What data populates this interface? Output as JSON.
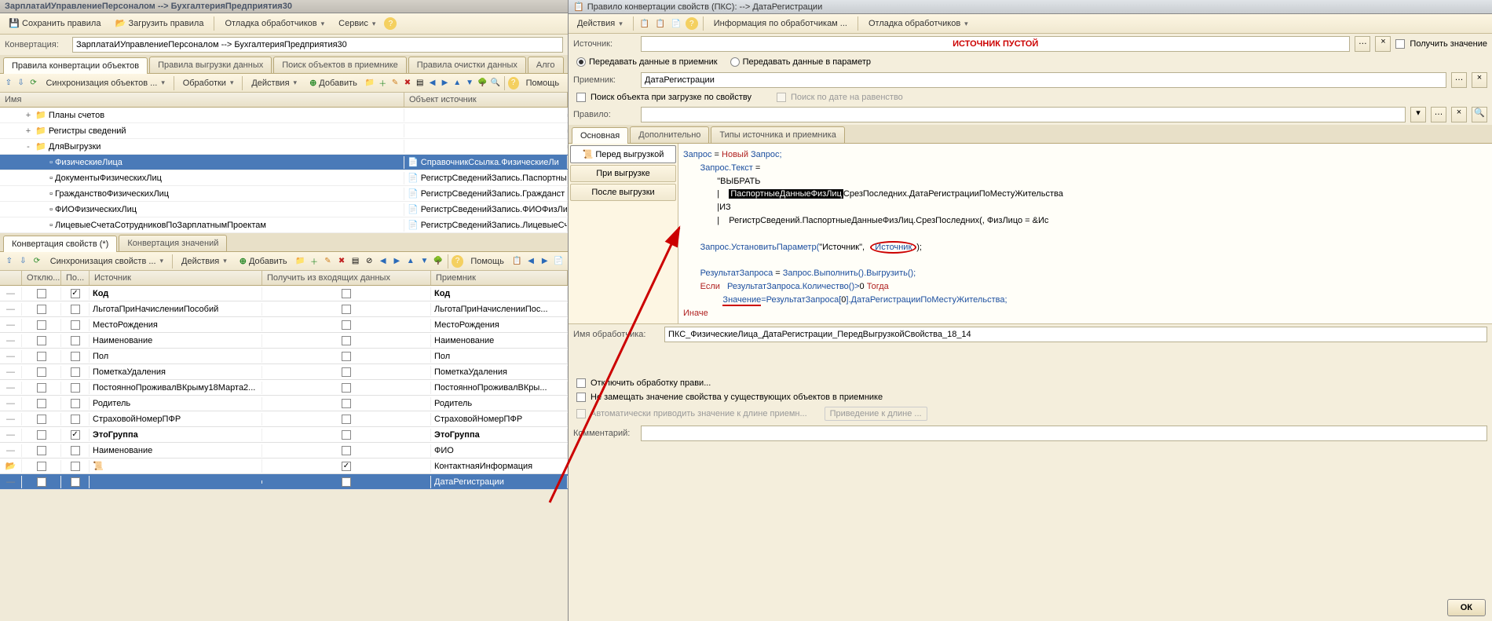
{
  "left": {
    "title": "ЗарплатаИУправлениеПерсоналом --> БухгалтерияПредприятия30",
    "toolbar": {
      "save_rules": "Сохранить правила",
      "load_rules": "Загрузить правила",
      "debug_handlers": "Отладка обработчиков",
      "service": "Сервис"
    },
    "conversion_label": "Конвертация:",
    "conversion_value": "ЗарплатаИУправлениеПерсоналом --> БухгалтерияПредприятия30",
    "tabs": [
      "Правила конвертации объектов",
      "Правила выгрузки данных",
      "Поиск объектов в приемнике",
      "Правила очистки данных",
      "Алго"
    ],
    "subtoolbar": {
      "sync_label": "Синхронизация объектов ...",
      "processing": "Обработки",
      "actions": "Действия",
      "add": "Добавить",
      "help": "Помощь"
    },
    "tree_headers": {
      "name": "Имя",
      "source": "Объект источник"
    },
    "tree": [
      {
        "level": 1,
        "exp": "+",
        "icon": "folder",
        "name": "Планы счетов",
        "src": ""
      },
      {
        "level": 1,
        "exp": "+",
        "icon": "folder",
        "name": "Регистры сведений",
        "src": ""
      },
      {
        "level": 1,
        "exp": "-",
        "icon": "folder",
        "name": "ДляВыгрузки",
        "src": ""
      },
      {
        "level": 2,
        "exp": "",
        "icon": "item",
        "name": "ФизическиеЛица",
        "src": "СправочникСсылка.ФизическиеЛи",
        "sel": true
      },
      {
        "level": 2,
        "exp": "",
        "icon": "item",
        "name": "ДокументыФизическихЛиц",
        "src": "РегистрСведенийЗапись.Паспортные"
      },
      {
        "level": 2,
        "exp": "",
        "icon": "item",
        "name": "ГражданствоФизическихЛиц",
        "src": "РегистрСведенийЗапись.Гражданст"
      },
      {
        "level": 2,
        "exp": "",
        "icon": "item",
        "name": "ФИОФизическихЛиц",
        "src": "РегистрСведенийЗапись.ФИОФизЛиц"
      },
      {
        "level": 2,
        "exp": "",
        "icon": "item",
        "name": "ЛицевыеСчетаСотрудниковПоЗарплатнымПроектам",
        "src": "РегистрСведенийЗапись.ЛицевыеСче"
      }
    ],
    "props_tabs": [
      "Конвертация свойств (*)",
      "Конвертация значений"
    ],
    "props_subtoolbar": {
      "sync_label": "Синхронизация свойств ...",
      "actions": "Действия",
      "add": "Добавить",
      "help": "Помощь"
    },
    "grid_headers": {
      "off": "Отклю...",
      "search": "По...",
      "source": "Источник",
      "incoming": "Получить из входящих данных",
      "dest": "Приемник"
    },
    "grid": [
      {
        "off": false,
        "search": true,
        "src": "Код",
        "inc": false,
        "dest": "Код",
        "bold": true
      },
      {
        "off": false,
        "search": false,
        "src": "ЛьготаПриНачисленииПособий",
        "inc": false,
        "dest": "ЛьготаПриНачисленииПос..."
      },
      {
        "off": false,
        "search": false,
        "src": "МестоРождения",
        "inc": false,
        "dest": "МестоРождения"
      },
      {
        "off": false,
        "search": false,
        "src": "Наименование",
        "inc": false,
        "dest": "Наименование"
      },
      {
        "off": false,
        "search": false,
        "src": "Пол",
        "inc": false,
        "dest": "Пол"
      },
      {
        "off": false,
        "search": false,
        "src": "ПометкаУдаления",
        "inc": false,
        "dest": "ПометкаУдаления"
      },
      {
        "off": false,
        "search": false,
        "src": "ПостоянноПроживалВКрыму18Марта2...",
        "inc": false,
        "dest": "ПостоянноПроживалВКры..."
      },
      {
        "off": false,
        "search": false,
        "src": "Родитель",
        "inc": false,
        "dest": "Родитель"
      },
      {
        "off": false,
        "search": false,
        "src": "СтраховойНомерПФР",
        "inc": false,
        "dest": "СтраховойНомерПФР"
      },
      {
        "off": false,
        "search": true,
        "src": "ЭтоГруппа",
        "inc": false,
        "dest": "ЭтоГруппа",
        "bold": true
      },
      {
        "off": false,
        "search": false,
        "src": "Наименование",
        "inc": false,
        "dest": "ФИО"
      },
      {
        "off": false,
        "search": false,
        "src": "",
        "inc": true,
        "dest": "КонтактнаяИнформация",
        "srcicon": true
      },
      {
        "off": false,
        "search": false,
        "src": "",
        "inc": false,
        "dest": "ДатаРегистрации",
        "sel": true
      }
    ]
  },
  "right": {
    "title": "Правило конвертации свойств (ПКС): --> ДатаРегистрации",
    "toolbar": {
      "actions": "Действия",
      "info_handlers": "Информация по обработчикам ...",
      "debug_handlers": "Отладка обработчиков"
    },
    "source_label": "Источник:",
    "source_placeholder": "ИСТОЧНИК ПУСТОЙ",
    "get_value": "Получить значение",
    "radio1": "Передавать данные в приемник",
    "radio2": "Передавать данные в параметр",
    "dest_label": "Приемник:",
    "dest_value": "ДатаРегистрации",
    "search_by_prop": "Поиск объекта при загрузке по свойству",
    "search_by_date": "Поиск по дате на равенство",
    "rule_label": "Правило:",
    "tabs": [
      "Основная",
      "Дополнительно",
      "Типы источника и приемника"
    ],
    "handlers": [
      "Перед выгрузкой",
      "При выгрузке",
      "После выгрузки"
    ],
    "handler_active": 0,
    "code": {
      "l1a": "Запрос",
      "l1b": " = ",
      "l1c": "Новый",
      "l1d": " Запрос;",
      "l2a": "Запрос.Текст",
      "l2b": " = ",
      "l3": "\"ВЫБРАТЬ",
      "l4a": "|    ",
      "l4hl": "ПаспортныеДанныеФизЛиц",
      "l4b": "СрезПоследних.ДатаРегистрацииПоМестуЖительства",
      "l5": "|ИЗ",
      "l6": "|    РегистрСведений.ПаспортныеДанныеФизЛиц.СрезПоследних(, ФизЛицо = &Ис",
      "l7a": "Запрос.УстановитьПараметр(",
      "l7b": "\"Источник\"",
      "l7c": ",",
      "l7d": "Источник",
      "l7e": ");",
      "l8a": "РезультатЗапроса",
      "l8b": " = ",
      "l8c": "Запрос.Выполнить().Выгрузить();",
      "l9a": "Если",
      "l9b": "   РезультатЗапроса.Количество()>",
      "l9c": "0",
      "l9d": " Тогда",
      "l10a": "Значение",
      "l10b": "=РезультатЗапроса[",
      "l10c": "0",
      "l10d": "].ДатаРегистрацииПоМестуЖительства;",
      "l11": "Иначе"
    },
    "handler_name_label": "Имя обработчика:",
    "handler_name_value": "ПКС_ФизическиеЛица_ДатаРегистрации_ПередВыгрузкойСвойства_18_14",
    "opt_disable": "Отключить обработку прави...",
    "opt_noreplace": "Не замещать значение свойства у существующих объектов в приемнике",
    "opt_autolen": "Автоматически приводить значение к длине приемн...",
    "btn_len": "Приведение к длине ...",
    "comment_label": "Комментарий:",
    "ok": "ОК"
  }
}
